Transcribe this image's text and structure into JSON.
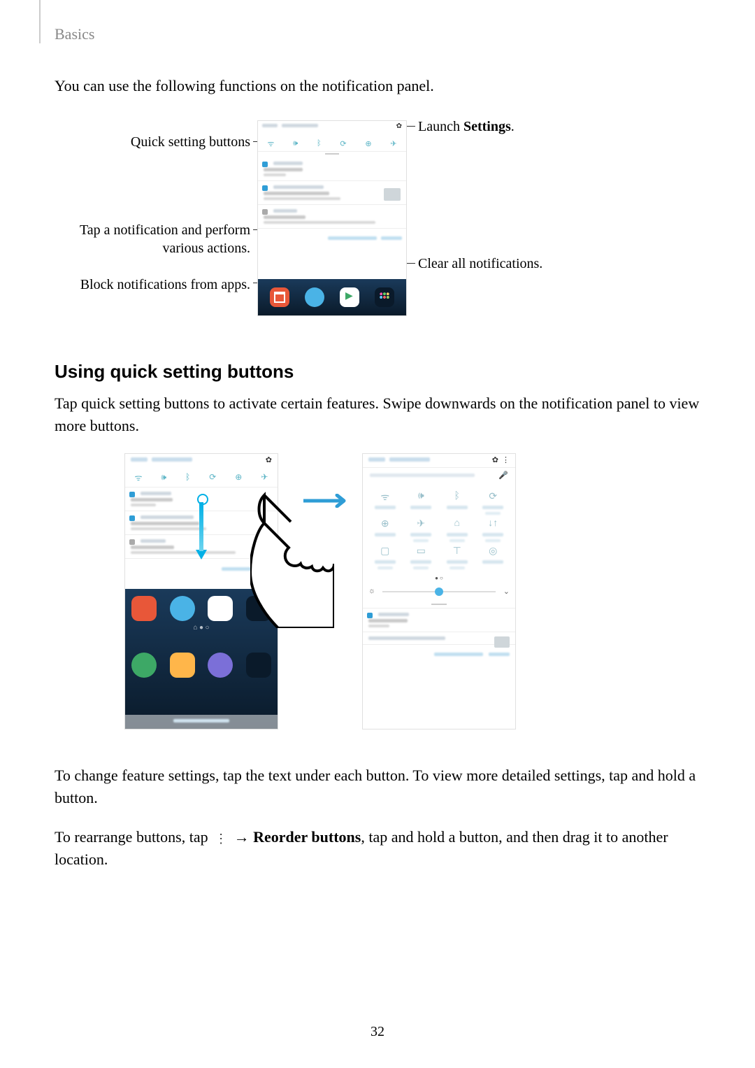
{
  "header": {
    "section": "Basics"
  },
  "intro": "You can use the following functions on the notification panel.",
  "fig1": {
    "callouts": {
      "quick_buttons": "Quick setting buttons",
      "tap_notification_l1": "Tap a notification and perform",
      "tap_notification_l2": "various actions.",
      "block": "Block notifications from apps.",
      "launch_settings_pre": "Launch ",
      "launch_settings_bold": "Settings",
      "launch_settings_post": ".",
      "clear_all": "Clear all notifications."
    }
  },
  "section_heading": "Using quick setting buttons",
  "para1": "Tap quick setting buttons to activate certain features. Swipe downwards on the notification panel to view more buttons.",
  "para2": "To change feature settings, tap the text under each button. To view more detailed settings, tap and hold a button.",
  "para3_pre": "To rearrange buttons, tap ",
  "para3_mid": " → ",
  "para3_bold": "Reorder buttons",
  "para3_post": ", tap and hold a button, and then drag it to another location.",
  "page_number": "32",
  "icons": {
    "gear": "✿",
    "more": "⋮",
    "mic": "🎤",
    "sun": "☼",
    "chevron": "⌄",
    "pager": "● ○"
  },
  "qs_icons": {
    "wifi": "ᯤ",
    "sound": "🕪",
    "bluetooth": "ᛒ",
    "rotate": "⟳",
    "flashlight": "⊕",
    "airplane": "✈",
    "hotspot": "⌂",
    "data_saver": "↓↑",
    "nfc": "▢",
    "file": "▭",
    "sync": "⊤",
    "location": "◎"
  }
}
